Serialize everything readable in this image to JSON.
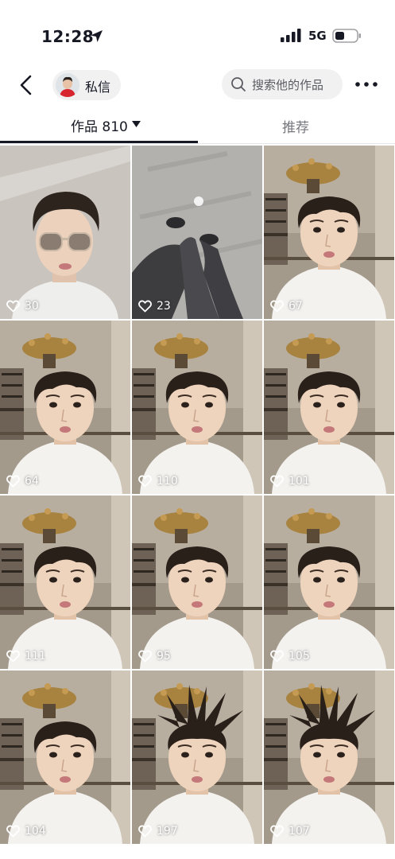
{
  "status_bar": {
    "time": "12:28",
    "network": "5G"
  },
  "header": {
    "dm_label": "私信",
    "search_placeholder": "搜索他的作品"
  },
  "tabs": {
    "works_label": "作品 810",
    "recommend_label": "推荐"
  },
  "videos": [
    {
      "likes": "30",
      "scene": "sunglasses"
    },
    {
      "likes": "23",
      "scene": "feet"
    },
    {
      "likes": "67",
      "scene": "face"
    },
    {
      "likes": "64",
      "scene": "face"
    },
    {
      "likes": "110",
      "scene": "face"
    },
    {
      "likes": "101",
      "scene": "face"
    },
    {
      "likes": "111",
      "scene": "face"
    },
    {
      "likes": "95",
      "scene": "face"
    },
    {
      "likes": "105",
      "scene": "face"
    },
    {
      "likes": "104",
      "scene": "face"
    },
    {
      "likes": "197",
      "scene": "spiky"
    },
    {
      "likes": "107",
      "scene": "spiky"
    }
  ],
  "icons": {
    "location": "location-arrow-icon",
    "signal": "cellular-signal-icon",
    "battery": "battery-icon",
    "back": "back-chevron-icon",
    "search": "search-icon",
    "more": "more-dots-icon",
    "caret": "caret-down-icon",
    "heart": "heart-outline-icon"
  },
  "colors": {
    "text": "#161823",
    "pill": "#f1f1f2",
    "muted": "#75767c"
  }
}
